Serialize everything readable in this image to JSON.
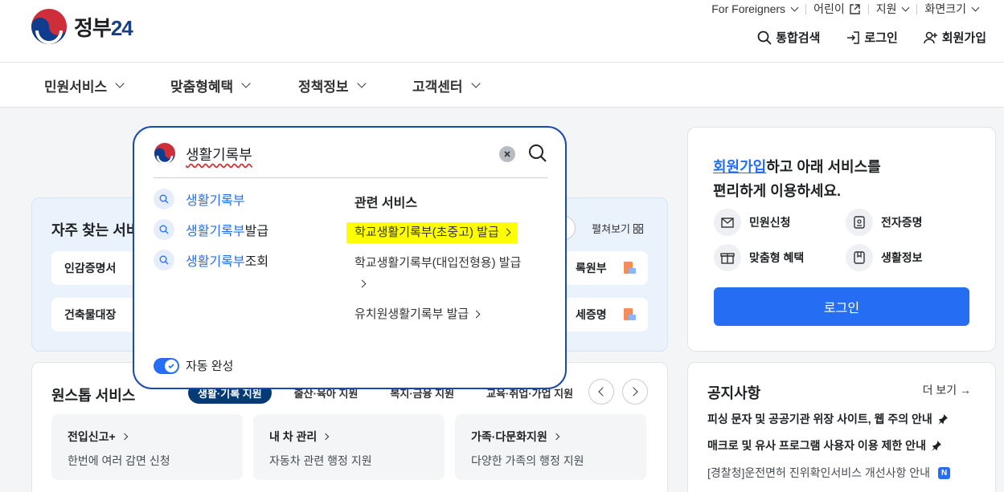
{
  "header": {
    "logo_text": "정부",
    "logo_num": "24",
    "util": [
      "For Foreigners",
      "어린이",
      "지원",
      "화면크기"
    ],
    "actions": [
      "통합검색",
      "로그인",
      "회원가입"
    ]
  },
  "gnb": [
    "민원서비스",
    "맞춤형혜택",
    "정책정보",
    "고객센터"
  ],
  "freq": {
    "title": "자주 찾는 서비",
    "toggle": "펼쳐보기",
    "items": [
      "인감증명서",
      "건축물대장",
      "록원부",
      "세증명"
    ]
  },
  "onestop": {
    "title": "원스톱 서비스",
    "tabs": [
      "생활·기록 지원",
      "출산·육아 지원",
      "복지·금융 지원",
      "교육·취업·가업 지원"
    ],
    "cards": [
      {
        "title": "전입신고+",
        "desc": "한번에 여러 감면 신청"
      },
      {
        "title": "내 차 관리",
        "desc": "자동차 관련 행정 지원"
      },
      {
        "title": "가족·다문화지원",
        "desc": "다양한 가족의 행정 지원"
      }
    ]
  },
  "login_card": {
    "title_link": "회원가입",
    "title_rest": "하고 아래 서비스를",
    "title_line2": "편리하게 이용하세요.",
    "services": [
      "민원신청",
      "전자증명",
      "맞춤형 혜택",
      "생활정보"
    ],
    "button": "로그인"
  },
  "notice": {
    "title": "공지사항",
    "more": "더 보기",
    "items": [
      "피싱 문자 및 공공기관 위장 사이트, 웹 주의 안내",
      "매크로 및 유사 프로그램 사용자 이용 제한 안내",
      "[경찰청]운전면허 진위확인서비스 개선사항 안내"
    ],
    "new_badge": "N"
  },
  "search": {
    "query": "생활기록부",
    "suggestions": [
      {
        "match": "생활기록부",
        "rest": ""
      },
      {
        "match": "생활기록부",
        "rest": "발급"
      },
      {
        "match": "생활기록부",
        "rest": "조회"
      }
    ],
    "related_title": "관련 서비스",
    "related": [
      "학교생활기록부(초중고) 발급",
      "학교생활기록부(대입전형용) 발급",
      "유치원생활기록부 발급"
    ],
    "autocomplete": "자동 완성"
  }
}
